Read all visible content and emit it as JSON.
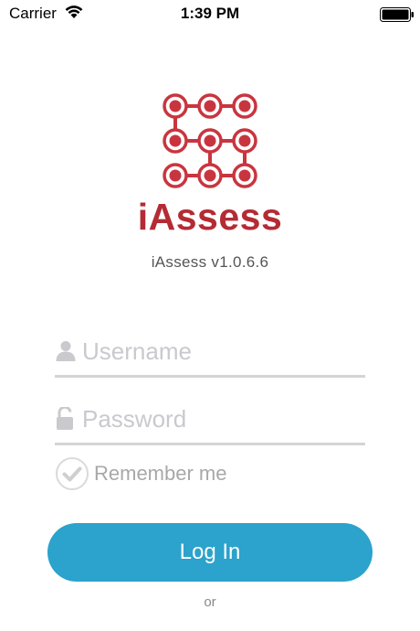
{
  "status_bar": {
    "carrier": "Carrier",
    "time": "1:39 PM",
    "wifi_icon": "wifi-icon",
    "battery_icon": "battery-icon"
  },
  "app": {
    "brand": "iAssess",
    "version": "iAssess v1.0.6.6",
    "logo_icon": "iassess-logo",
    "brand_color": "#b42b34"
  },
  "login_form": {
    "username": {
      "placeholder": "Username",
      "value": "",
      "icon": "user-icon"
    },
    "password": {
      "placeholder": "Password",
      "value": "",
      "icon": "lock-icon"
    },
    "remember_me": {
      "label": "Remember me",
      "icon": "checkmark-icon",
      "checked": false
    },
    "login_button": {
      "label": "Log In",
      "color": "#2ba3cc"
    },
    "or_text": "or"
  }
}
